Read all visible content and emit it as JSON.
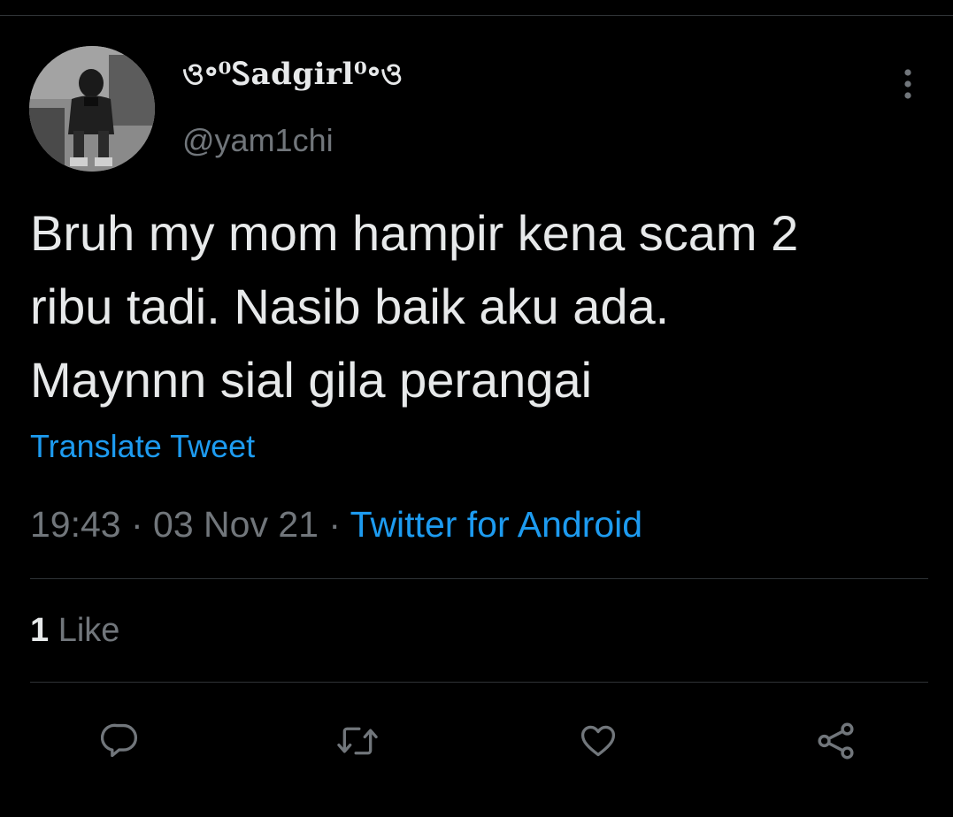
{
  "tweet": {
    "author": {
      "display_name": "ও॰⁰Ꮪadgirl⁰॰ও",
      "handle": "@yam1chi",
      "avatar_icon": "avatar-photo"
    },
    "text": "Bruh my mom hampir kena scam 2\nribu tadi. Nasib baik aku ada.\nMaynnn sial gila perangai",
    "translate_label": "Translate Tweet",
    "time": "19:43",
    "date": "03 Nov 21",
    "separator": " · ",
    "source": "Twitter for Android",
    "likes": {
      "count": "1",
      "label": "Like"
    }
  },
  "actions": [
    {
      "name": "reply",
      "icon": "reply-icon"
    },
    {
      "name": "retweet",
      "icon": "retweet-icon"
    },
    {
      "name": "like",
      "icon": "heart-icon"
    },
    {
      "name": "share",
      "icon": "share-icon"
    }
  ],
  "colors": {
    "background": "#000000",
    "text": "#e7e9ea",
    "secondary": "#71767b",
    "accent": "#1d9bf0",
    "divider": "#2f3336"
  }
}
